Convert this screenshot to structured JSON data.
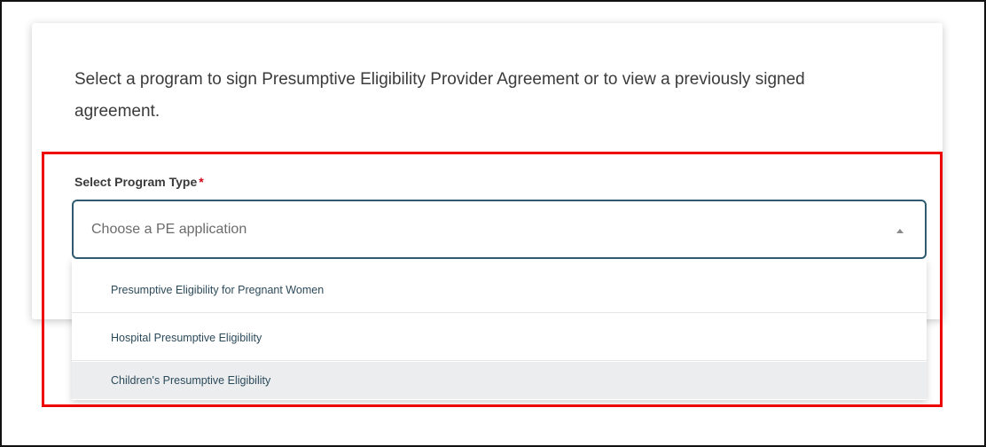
{
  "intro_text": "Select a program to sign Presumptive Eligibility Provider Agreement or to view a previously signed agreement.",
  "program_field": {
    "label": "Select Program Type",
    "required_marker": "*",
    "placeholder": "Choose a PE application",
    "expanded": true,
    "options": [
      {
        "label": "Presumptive Eligibility for Pregnant Women",
        "hovered": false
      },
      {
        "label": "Hospital Presumptive Eligibility",
        "hovered": false
      },
      {
        "label": "Children's Presumptive Eligibility",
        "hovered": true
      }
    ]
  },
  "colors": {
    "highlight_border": "#ee0000",
    "select_border": "#2f5a70",
    "required_star": "#d0021b",
    "hover_row": "#ebedef"
  },
  "icons": {
    "caret": "caret-up-icon"
  }
}
